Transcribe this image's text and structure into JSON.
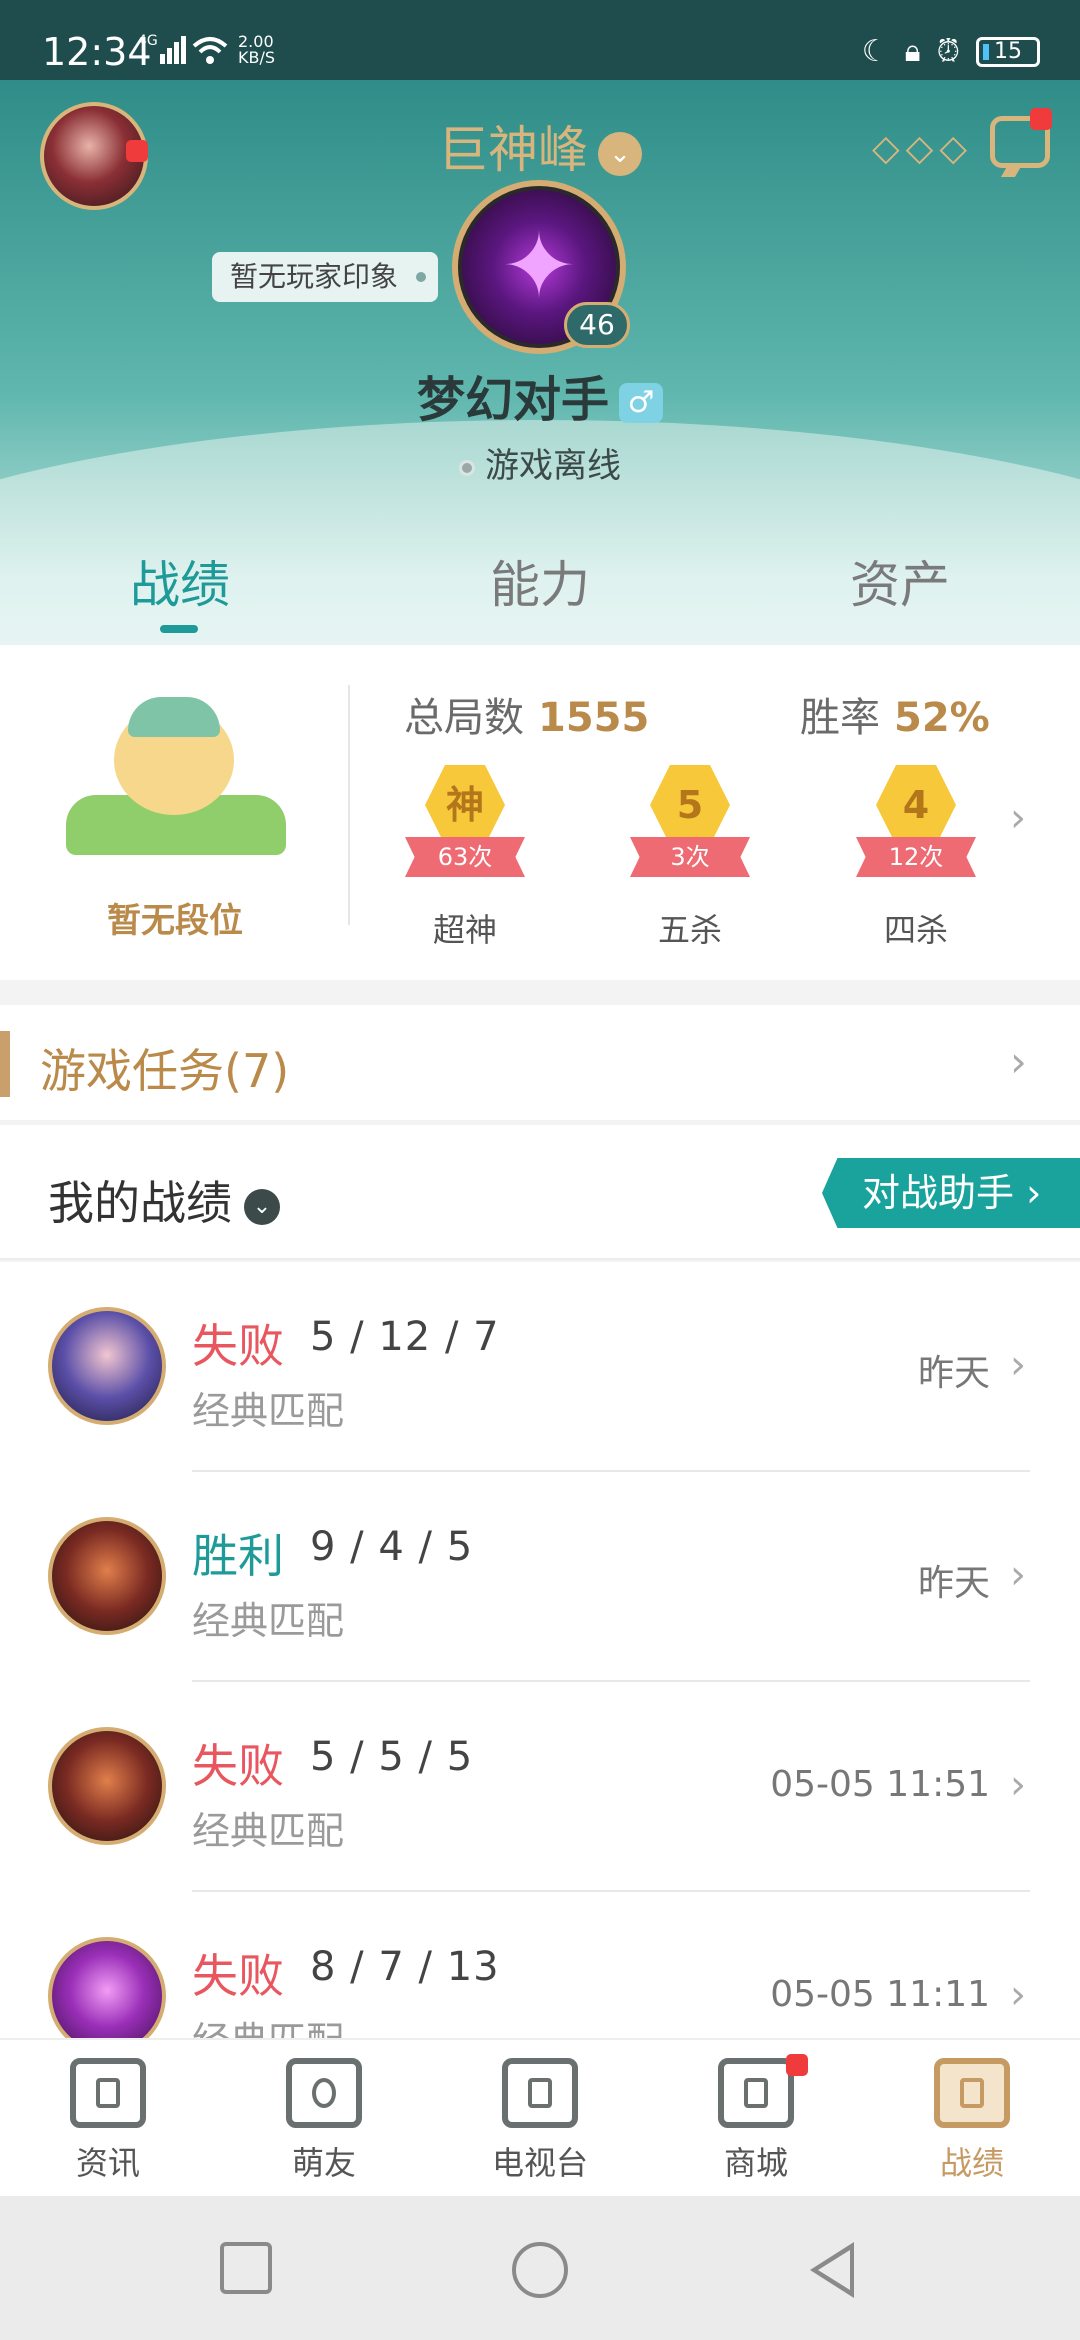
{
  "status_bar": {
    "time": "12:34",
    "network": "4G",
    "speed": "2.00",
    "speed_unit": "KB/S",
    "battery": "15"
  },
  "header": {
    "server_name": "巨神峰",
    "impression": "暂无玩家印象",
    "level": "46",
    "nickname": "梦幻对手",
    "gender_symbol": "♂",
    "online_status": "游戏离线",
    "icons": [
      "avatar",
      "more-icon",
      "chat-icon",
      "gender-icon"
    ]
  },
  "tabs": [
    "战绩",
    "能力",
    "资产"
  ],
  "stats": {
    "rank_label": "暂无段位",
    "total_label": "总局数",
    "total_value": "1555",
    "winrate_label": "胜率",
    "winrate_value": "52%",
    "medals": [
      {
        "glyph": "神",
        "count": "63次",
        "label": "超神"
      },
      {
        "glyph": "5",
        "count": "3次",
        "label": "五杀"
      },
      {
        "glyph": "4",
        "count": "12次",
        "label": "四杀"
      }
    ]
  },
  "tasks": {
    "label": "游戏任务(7)"
  },
  "records": {
    "title": "我的战绩",
    "assistant_button": "对战助手 ›",
    "matches": [
      {
        "result": "失败",
        "kda": "5 / 12 / 7",
        "mode": "经典匹配",
        "time": "昨天",
        "outcome": "lose"
      },
      {
        "result": "胜利",
        "kda": "9 / 4 / 5",
        "mode": "经典匹配",
        "time": "昨天",
        "outcome": "win"
      },
      {
        "result": "失败",
        "kda": "5 / 5 / 5",
        "mode": "经典匹配",
        "time": "05-05 11:51",
        "outcome": "lose"
      },
      {
        "result": "失败",
        "kda": "8 / 7 / 13",
        "mode": "经典匹配",
        "time": "05-05 11:11",
        "outcome": "lose"
      }
    ]
  },
  "bottom_nav": [
    {
      "label": "资讯",
      "icon": "news-icon"
    },
    {
      "label": "萌友",
      "icon": "friends-icon"
    },
    {
      "label": "电视台",
      "icon": "tv-icon"
    },
    {
      "label": "商城",
      "icon": "shop-icon"
    },
    {
      "label": "战绩",
      "icon": "records-icon"
    }
  ],
  "colors": {
    "accent_teal": "#1e9a98",
    "gold": "#b98a4a",
    "lose_red": "#e8575f"
  }
}
